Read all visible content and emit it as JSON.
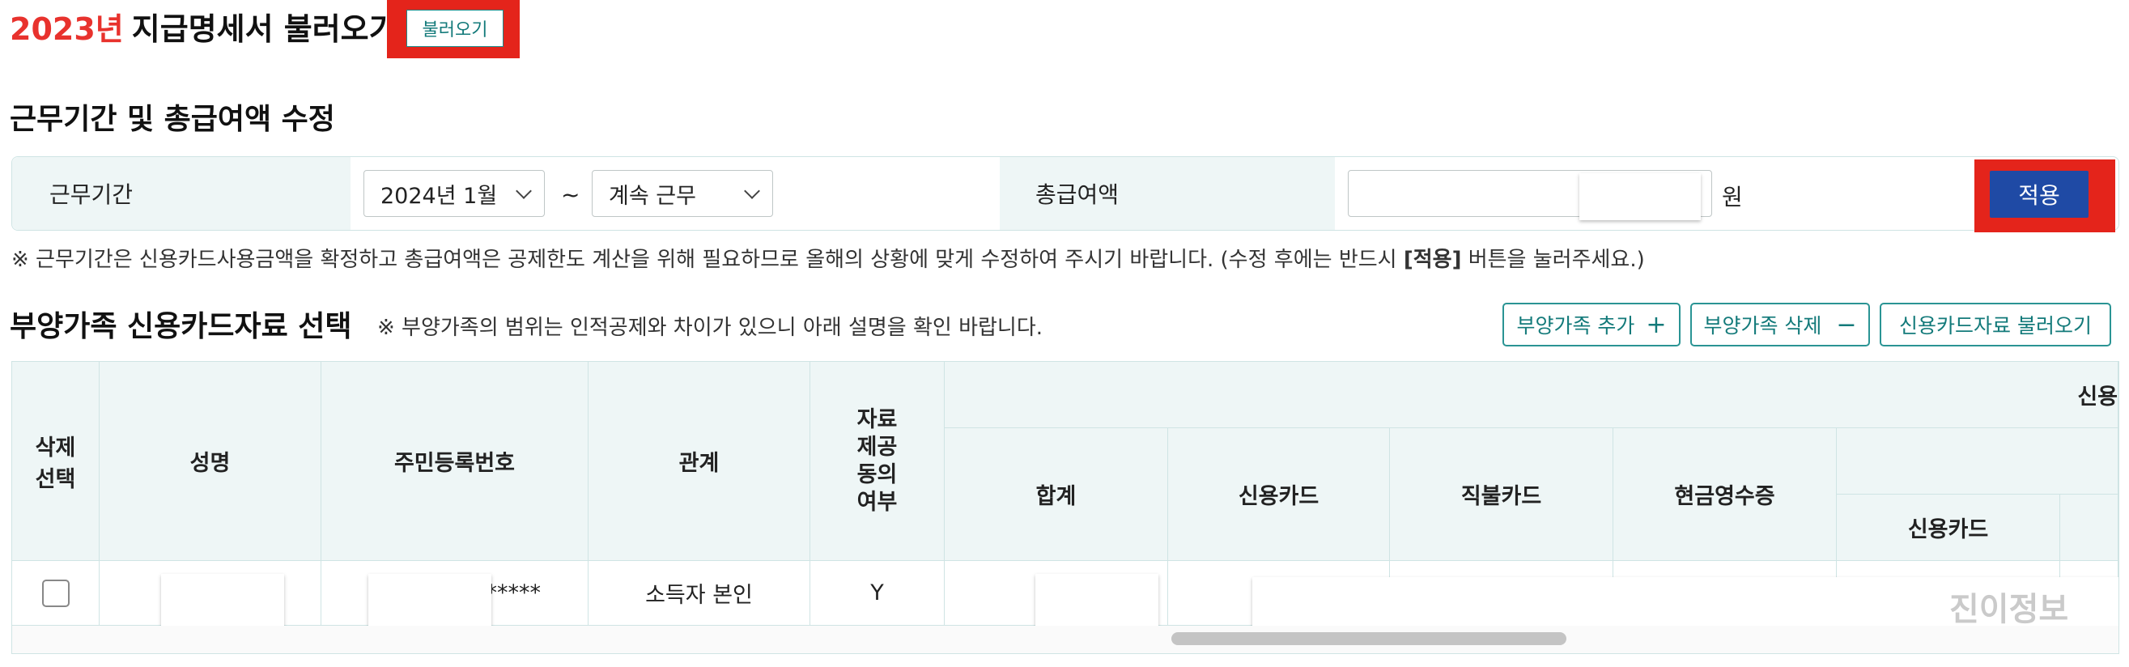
{
  "header": {
    "year": "2023년",
    "title": "지급명세서 불러오기",
    "load_button": "불러오기"
  },
  "work_period_section": {
    "title": "근무기간 및 총급여액 수정",
    "period_label": "근무기간",
    "start_select": "2024년 1월",
    "separator": "~",
    "end_select": "계속 근무",
    "salary_label": "총급여액",
    "salary_unit": "원",
    "apply_button": "적용",
    "note_before": "※ 근무기간은 신용카드사용금액을 확정하고 총급여액은 공제한도 계산을 위해 필요하므로 올해의 상황에 맞게 수정하여 주시기 바랍니다. (수정 후에는 반드시 ",
    "note_bold": "[적용]",
    "note_after": " 버튼을 눌러주세요.)"
  },
  "dependents_section": {
    "title": "부양가족 신용카드자료 선택",
    "subtitle": "※ 부양가족의 범위는 인적공제와 차이가 있으니 아래 설명을 확인 바랍니다.",
    "buttons": {
      "add": "부양가족 추가",
      "add_icon": "+",
      "delete": "부양가족 삭제",
      "delete_icon": "−",
      "load": "신용카드자료 불러오기"
    }
  },
  "table": {
    "headers": {
      "select": "삭제\n선택",
      "name": "성명",
      "rrn": "주민등록번호",
      "relation": "관계",
      "consent": "자료\n제공\n동의\n여부",
      "group": "신용",
      "total": "합계",
      "credit": "신용카드",
      "debit": "직불카드",
      "cash": "현금영수증",
      "sub_credit": "신용카드"
    },
    "rows": [
      {
        "rrn_suffix": "*****",
        "relation": "소득자 본인",
        "consent": "Y"
      }
    ]
  },
  "watermark": "진이정보"
}
